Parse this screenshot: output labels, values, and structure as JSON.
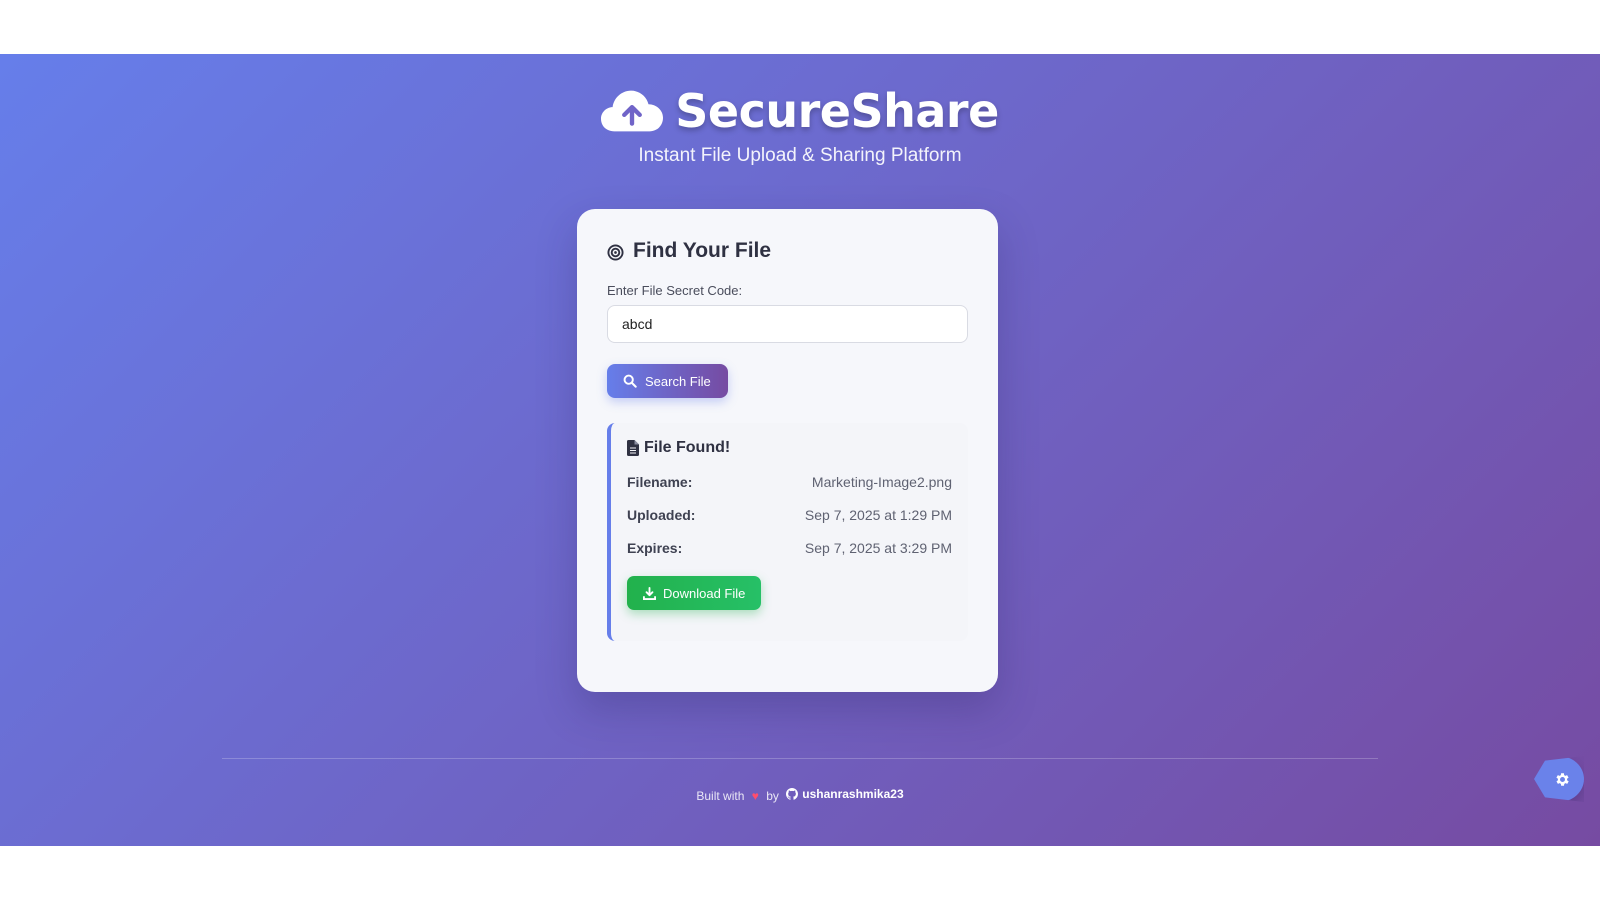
{
  "header": {
    "brand_icon": "cloud-upload-icon",
    "title": "SecureShare",
    "tagline": "Instant File Upload & Sharing Platform"
  },
  "finder": {
    "title_icon": "target-icon",
    "title": "Find Your File",
    "input_label": "Enter File Secret Code:",
    "input_value": "abcd",
    "search_button_icon": "search-icon",
    "search_button": "Search File"
  },
  "result": {
    "title_icon": "document-icon",
    "title": "File Found!",
    "rows": [
      {
        "label": "Filename:",
        "value": "Marketing-Image2.png"
      },
      {
        "label": "Uploaded:",
        "value": "Sep 7, 2025 at 1:29 PM"
      },
      {
        "label": "Expires:",
        "value": "Sep 7, 2025 at 3:29 PM"
      }
    ],
    "download_button_icon": "download-icon",
    "download_button": "Download File"
  },
  "footer": {
    "prefix": "Built with",
    "heart": "♥",
    "by": "by",
    "github_icon": "github-icon",
    "author": "ushanrashmika23"
  },
  "settings_icon": "gear-icon",
  "colors": {
    "gradient_start": "#667eea",
    "gradient_end": "#764ba2",
    "download_green": "#22b14c",
    "card_bg": "#f6f7fb",
    "heart": "#ff4d6d"
  }
}
